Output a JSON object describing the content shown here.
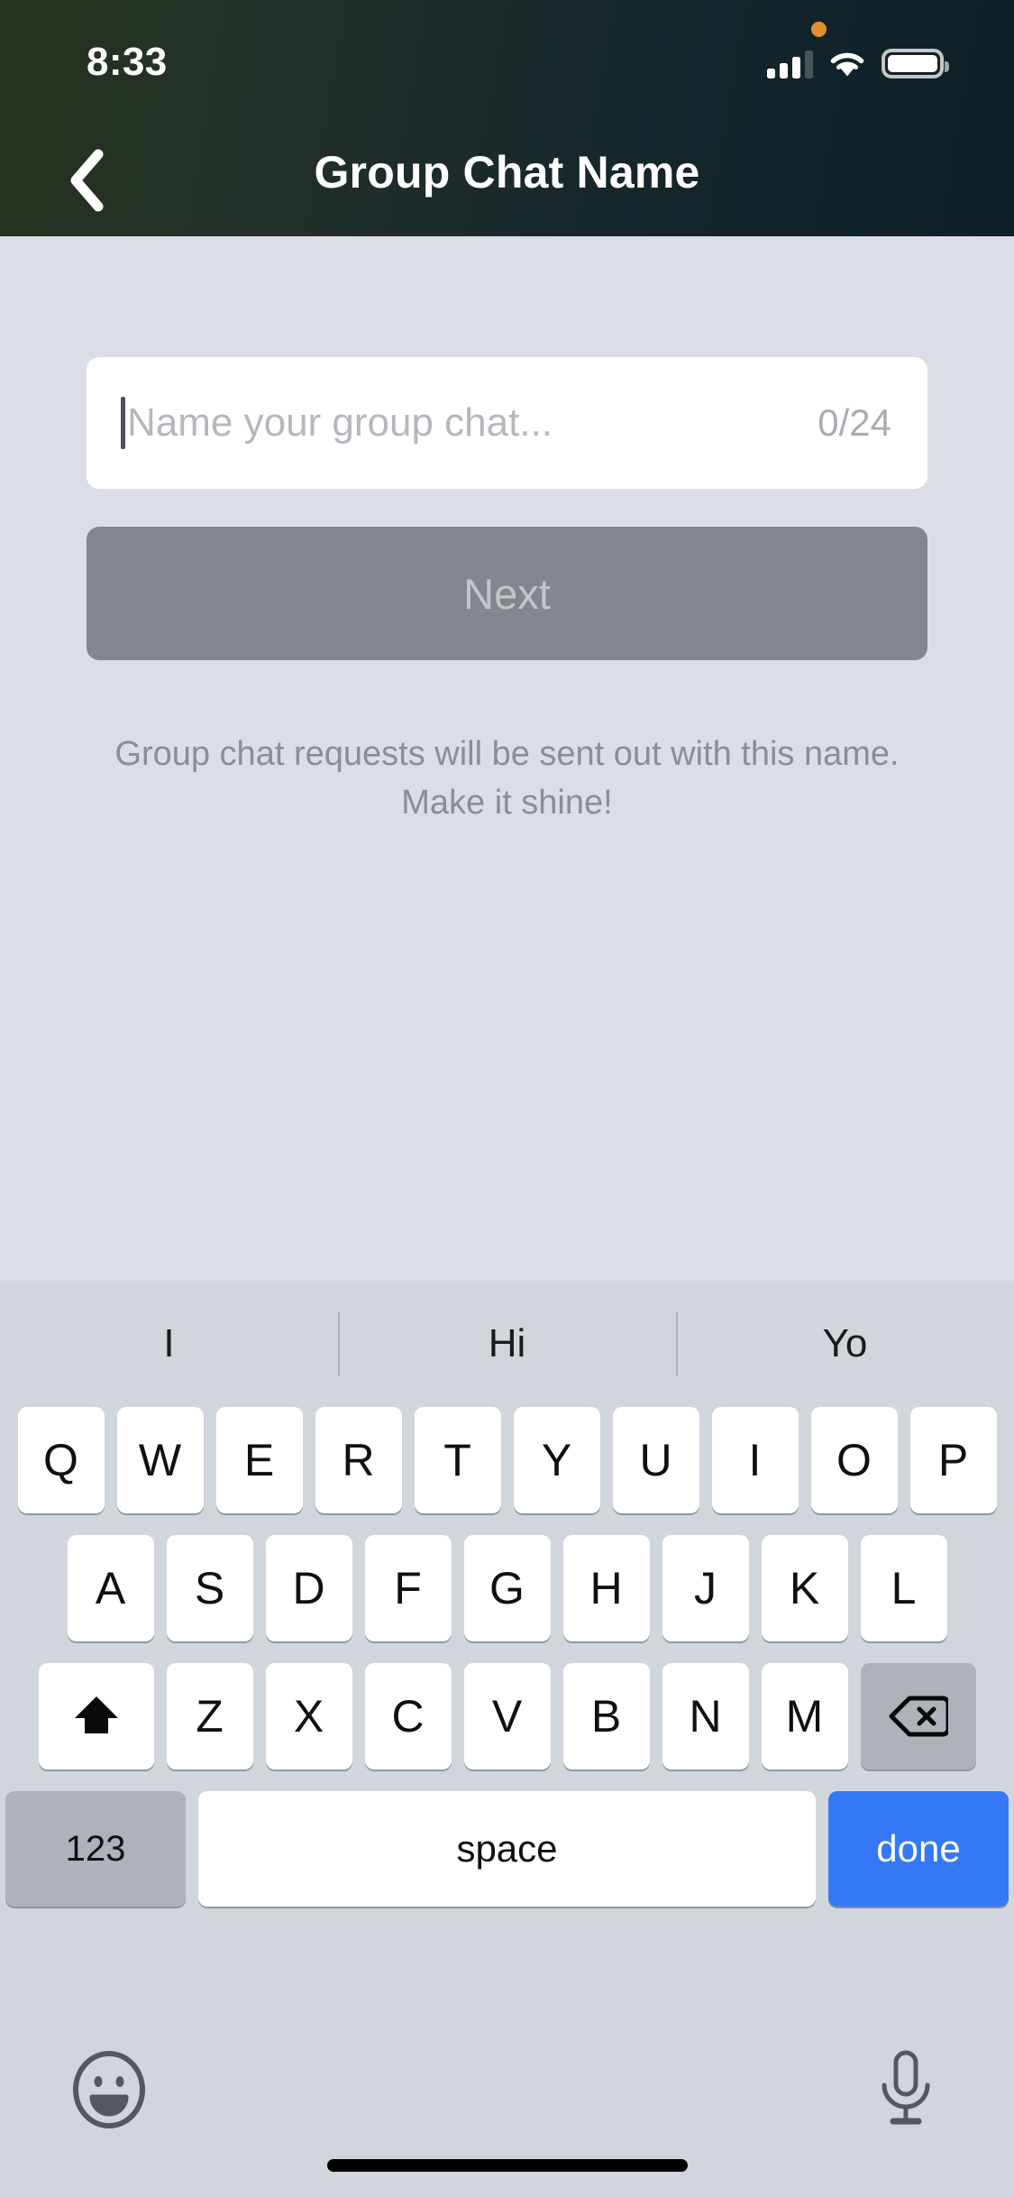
{
  "status_bar": {
    "time": "8:33",
    "recording_dot": "orange-recording-indicator",
    "signal_bars_filled": 3,
    "signal_bars_total": 4,
    "wifi": "wifi-icon",
    "battery": "battery-full-icon"
  },
  "header": {
    "title": "Group Chat Name",
    "back_icon": "chevron-left-icon",
    "gradient_start": "#26331f",
    "gradient_end": "#0d2027"
  },
  "form": {
    "name_input": {
      "value": "",
      "placeholder": "Name your group chat...",
      "counter": "0/24",
      "max_length": 24
    },
    "next_button": {
      "label": "Next",
      "enabled": false,
      "bg_color": "#83868d",
      "text_color": "#c2c5c9"
    },
    "helper_text": "Group chat requests will be sent out with this name. Make it shine!"
  },
  "keyboard": {
    "suggestions": [
      "I",
      "Hi",
      "Yo"
    ],
    "row1": [
      "Q",
      "W",
      "E",
      "R",
      "T",
      "Y",
      "U",
      "I",
      "O",
      "P"
    ],
    "row2": [
      "A",
      "S",
      "D",
      "F",
      "G",
      "H",
      "J",
      "K",
      "L"
    ],
    "row3_letters": [
      "Z",
      "X",
      "C",
      "V",
      "B",
      "N",
      "M"
    ],
    "shift_icon": "shift-arrow-up-icon",
    "backspace_icon": "backspace-delete-icon",
    "numeric_key": "123",
    "space_key": "space",
    "done_key": "done",
    "done_color": "#3478f6",
    "emoji_icon": "emoji-smiley-icon",
    "mic_icon": "microphone-icon",
    "bg_color": "#d1d5dc"
  }
}
